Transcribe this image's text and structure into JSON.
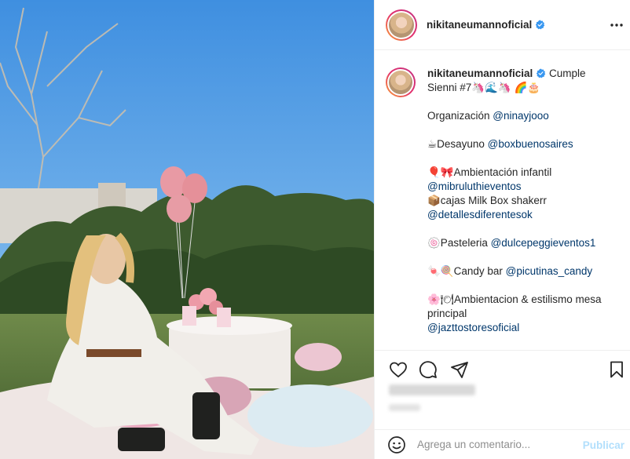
{
  "post": {
    "username": "nikitaneumannoficial",
    "verified": true,
    "more_icon": "more-horizontal-icon"
  },
  "caption": {
    "username": "nikitaneumannoficial",
    "lines": [
      {
        "type": "first",
        "text": "Cumple"
      },
      {
        "type": "plain",
        "text": "Sienni #7🦄🌊🦄 🌈🎂"
      },
      {
        "type": "gap"
      },
      {
        "type": "mention",
        "prefix": "Organización ",
        "mention": "@ninayjooo"
      },
      {
        "type": "gap"
      },
      {
        "type": "mention",
        "prefix": "☕Desayuno ",
        "mention": "@boxbuenosaires"
      },
      {
        "type": "gap"
      },
      {
        "type": "plain",
        "text": "🎈🎀Ambientación infantil"
      },
      {
        "type": "mention",
        "prefix": "",
        "mention": "@mibruluthieventos"
      },
      {
        "type": "plain",
        "text": "📦cajas Milk Box shakerr"
      },
      {
        "type": "mention",
        "prefix": "",
        "mention": "@detallesdiferentesok"
      },
      {
        "type": "gap"
      },
      {
        "type": "mention",
        "prefix": "🍥Pasteleria ",
        "mention": "@dulcepeggieventos1"
      },
      {
        "type": "gap"
      },
      {
        "type": "mention",
        "prefix": "🍬🍭Candy bar ",
        "mention": "@picutinas_candy"
      },
      {
        "type": "gap"
      },
      {
        "type": "plain",
        "text": "🌸🍽Ambientacion & estilismo mesa"
      },
      {
        "type": "plain",
        "text": "principal"
      },
      {
        "type": "mention",
        "prefix": "",
        "mention": "@jazttostoresoficial"
      }
    ]
  },
  "actions": {
    "like_icon": "heart-icon",
    "comment_icon": "comment-icon",
    "share_icon": "share-icon",
    "save_icon": "bookmark-icon"
  },
  "comment": {
    "placeholder": "Agrega un comentario...",
    "post_label": "Publicar",
    "emoji_icon": "emoji-icon"
  },
  "colors": {
    "mention": "#00376b",
    "verified": "#3897f0",
    "publish_disabled": "#b2dffc"
  }
}
